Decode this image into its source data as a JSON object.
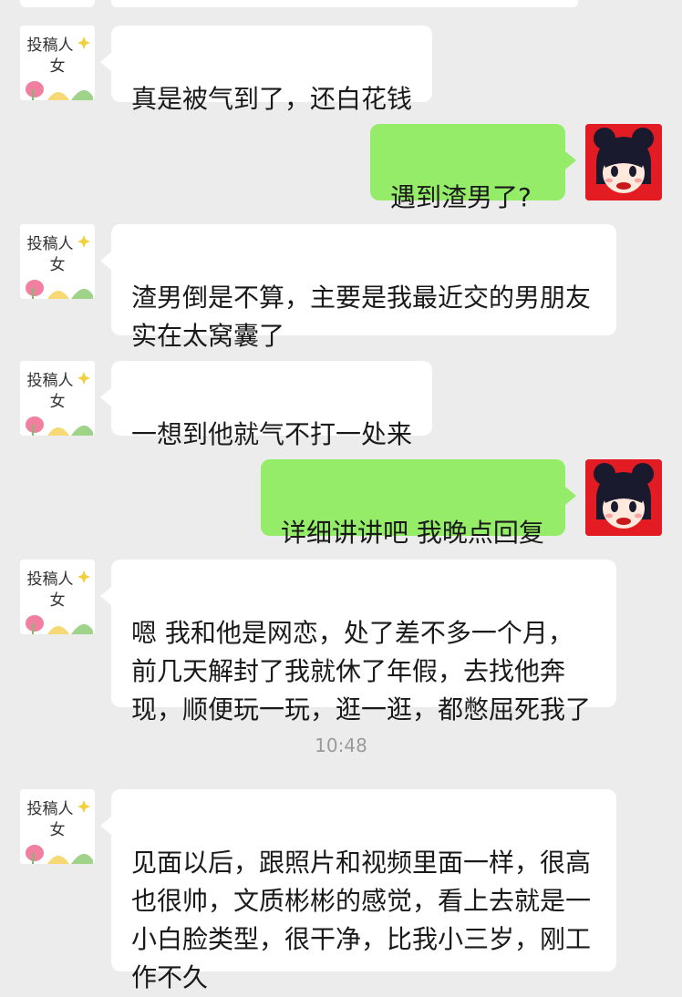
{
  "contact": {
    "avatar_text_line1": "投稿人",
    "avatar_text_line2": "女"
  },
  "colors": {
    "background": "#ececec",
    "incoming_bubble": "#ffffff",
    "outgoing_bubble": "#95ec69",
    "my_avatar_bg": "#e31b23"
  },
  "messages": [
    {
      "side": "left",
      "text": "真是被气到了，还白花钱"
    },
    {
      "side": "right",
      "text": "遇到渣男了?"
    },
    {
      "side": "left",
      "text": "渣男倒是不算，主要是我最近交的男朋友\n实在太窝囊了"
    },
    {
      "side": "left",
      "text": "一想到他就气不打一处来"
    },
    {
      "side": "right",
      "text": "详细讲讲吧 我晚点回复"
    },
    {
      "side": "left",
      "text": "嗯 我和他是网恋，处了差不多一个月，\n前几天解封了我就休了年假，去找他奔\n现，顺便玩一玩，逛一逛，都憋屈死我了"
    },
    {
      "side": "left",
      "text": "见面以后，跟照片和视频里面一样，很高\n也很帅，文质彬彬的感觉，看上去就是一\n小白脸类型，很干净，比我小三岁，刚工\n作不久"
    }
  ],
  "timestamp": "10:48"
}
